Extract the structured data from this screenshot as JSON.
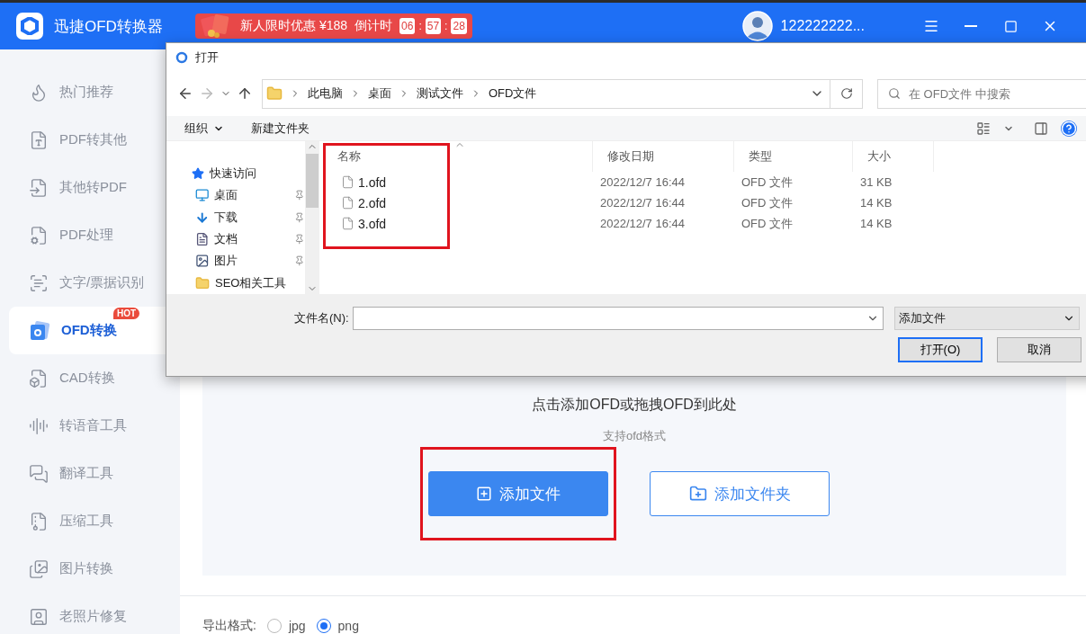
{
  "app": {
    "title": "迅捷OFD转换器"
  },
  "promo": {
    "text": "新人限时优惠 ¥188",
    "countdown_label": "倒计时",
    "countdown": [
      "06",
      "57",
      "28"
    ],
    "separator": ":"
  },
  "user": {
    "name": "122222222..."
  },
  "sidebar": {
    "items": [
      {
        "label": "热门推荐",
        "selected": false
      },
      {
        "label": "PDF转其他",
        "selected": false
      },
      {
        "label": "其他转PDF",
        "selected": false
      },
      {
        "label": "PDF处理",
        "selected": false
      },
      {
        "label": "文字/票据识别",
        "selected": false
      },
      {
        "label": "OFD转换",
        "selected": true,
        "badge": "HOT"
      },
      {
        "label": "CAD转换",
        "selected": false
      },
      {
        "label": "转语音工具",
        "selected": false
      },
      {
        "label": "翻译工具",
        "selected": false
      },
      {
        "label": "压缩工具",
        "selected": false
      },
      {
        "label": "图片转换",
        "selected": false
      },
      {
        "label": "老照片修复",
        "selected": false
      }
    ]
  },
  "dialog": {
    "title": "打开",
    "breadcrumb": [
      "此电脑",
      "桌面",
      "测试文件",
      "OFD文件"
    ],
    "search": {
      "placeholder": "在 OFD文件 中搜索"
    },
    "toolbar": [
      "组织",
      "新建文件夹"
    ],
    "nav": [
      {
        "label": "快速访问",
        "kind": "header",
        "pinned": false
      },
      {
        "label": "桌面",
        "kind": "desktop",
        "pinned": true
      },
      {
        "label": "下载",
        "kind": "download",
        "pinned": true
      },
      {
        "label": "文档",
        "kind": "document",
        "pinned": true
      },
      {
        "label": "图片",
        "kind": "picture",
        "pinned": true
      },
      {
        "label": "SEO相关工具",
        "kind": "folder",
        "pinned": false
      }
    ],
    "columns": [
      "名称",
      "修改日期",
      "类型",
      "大小"
    ],
    "files": [
      {
        "name": "1.ofd",
        "modified": "2022/12/7 16:44",
        "type": "OFD 文件",
        "size": "31 KB"
      },
      {
        "name": "2.ofd",
        "modified": "2022/12/7 16:44",
        "type": "OFD 文件",
        "size": "14 KB"
      },
      {
        "name": "3.ofd",
        "modified": "2022/12/7 16:44",
        "type": "OFD 文件",
        "size": "14 KB"
      }
    ],
    "filename": {
      "label": "文件名(N):"
    },
    "filter": "添加文件",
    "buttons": [
      {
        "label": "打开(O)",
        "kind": "default"
      },
      {
        "label": "取消",
        "kind": "normal"
      }
    ]
  },
  "drop_zone": {
    "prompt": "点击添加OFD或拖拽OFD到此处",
    "hint": "支持ofd格式",
    "buttons": [
      {
        "label": "添加文件",
        "kind": "primary",
        "highlighted": true
      },
      {
        "label": "添加文件夹",
        "kind": "outline",
        "highlighted": false
      }
    ]
  },
  "export": {
    "label": "导出格式:",
    "options": [
      {
        "label": "jpg",
        "selected": false
      },
      {
        "label": "png",
        "selected": true
      }
    ]
  }
}
